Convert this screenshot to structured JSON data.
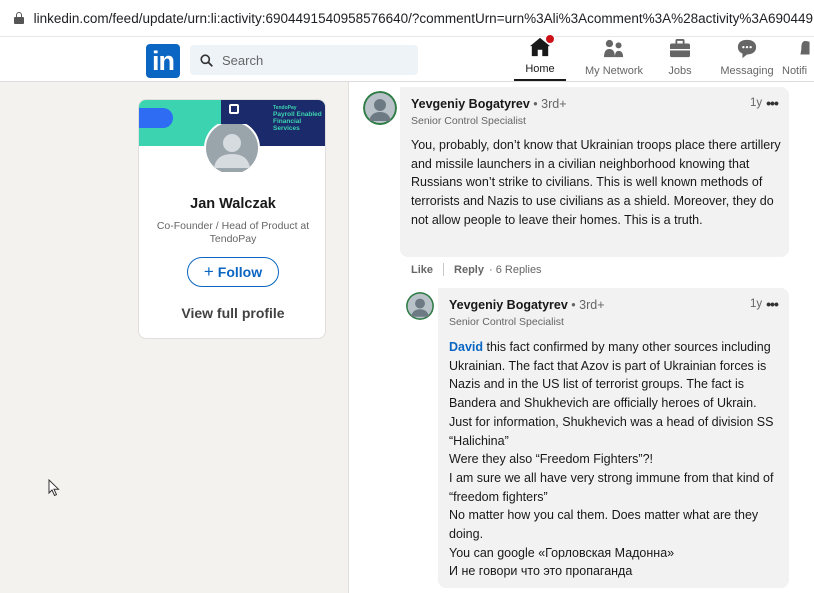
{
  "browser": {
    "url": "linkedin.com/feed/update/urn:li:activity:6904491540958576640/?commentUrn=urn%3Ali%3Acomment%3A%28activity%3A6904491540"
  },
  "nav": {
    "logo": "in",
    "search_placeholder": "Search",
    "items": [
      {
        "label": "Home",
        "icon": "home-icon"
      },
      {
        "label": "My Network",
        "icon": "network-icon"
      },
      {
        "label": "Jobs",
        "icon": "jobs-icon"
      },
      {
        "label": "Messaging",
        "icon": "messaging-icon"
      },
      {
        "label": "Notifi",
        "icon": "notifications-icon"
      }
    ]
  },
  "profile_card": {
    "banner_brand": "TendoPay",
    "banner_text": "Payroll Enabled Financial Services",
    "name": "Jan Walczak",
    "title": "Co-Founder / Head of Product at TendoPay",
    "follow_label": "Follow",
    "view_profile": "View full profile"
  },
  "comments": [
    {
      "author": "Yevgeniy Bogatyrev",
      "degree": "• 3rd+",
      "subtitle": "Senior Control Specialist",
      "time": "1y",
      "text": "You, probably, don’t know that Ukrainian troops place there artillery and missile launchers in a civilian neighborhood knowing that Russians won’t strike to civilians. This is well known methods of terrorists and Nazis to use civilians as a shield. Moreover, they do not allow people to leave their homes. This is a truth.",
      "actions": {
        "like": "Like",
        "reply": "Reply",
        "replies": "· 6 Replies"
      }
    },
    {
      "author": "Yevgeniy Bogatyrev",
      "degree": "• 3rd+",
      "subtitle": "Senior Control Specialist",
      "time": "1y",
      "mention": "David",
      "lines": [
        "this fact confirmed by many other sources including Ukrainian. The fact that Azov is part of Ukrainian forces is Nazis and in the US list of terrorist groups. The fact is Bandera and Shukhevich are officially heroes of Ukrain. Just for information, Shukhevich was a head of division SS “Halichina”",
        "Were they also “Freedom Fighters”?!",
        "I am sure we all have very strong immune from that kind of “freedom fighters”",
        "No matter how you cal them. Does matter what are they doing.",
        "You can google «Горловская Мадонна»",
        "И не говори что это пропаганда"
      ]
    }
  ],
  "colors": {
    "linkedin_blue": "#0a66c2",
    "page_bg": "#f3f2ef",
    "bubble_bg": "#f2f2f2",
    "notification_red": "#cc1016",
    "banner_teal": "#3cd4b0",
    "banner_navy": "#1b2a6b"
  }
}
